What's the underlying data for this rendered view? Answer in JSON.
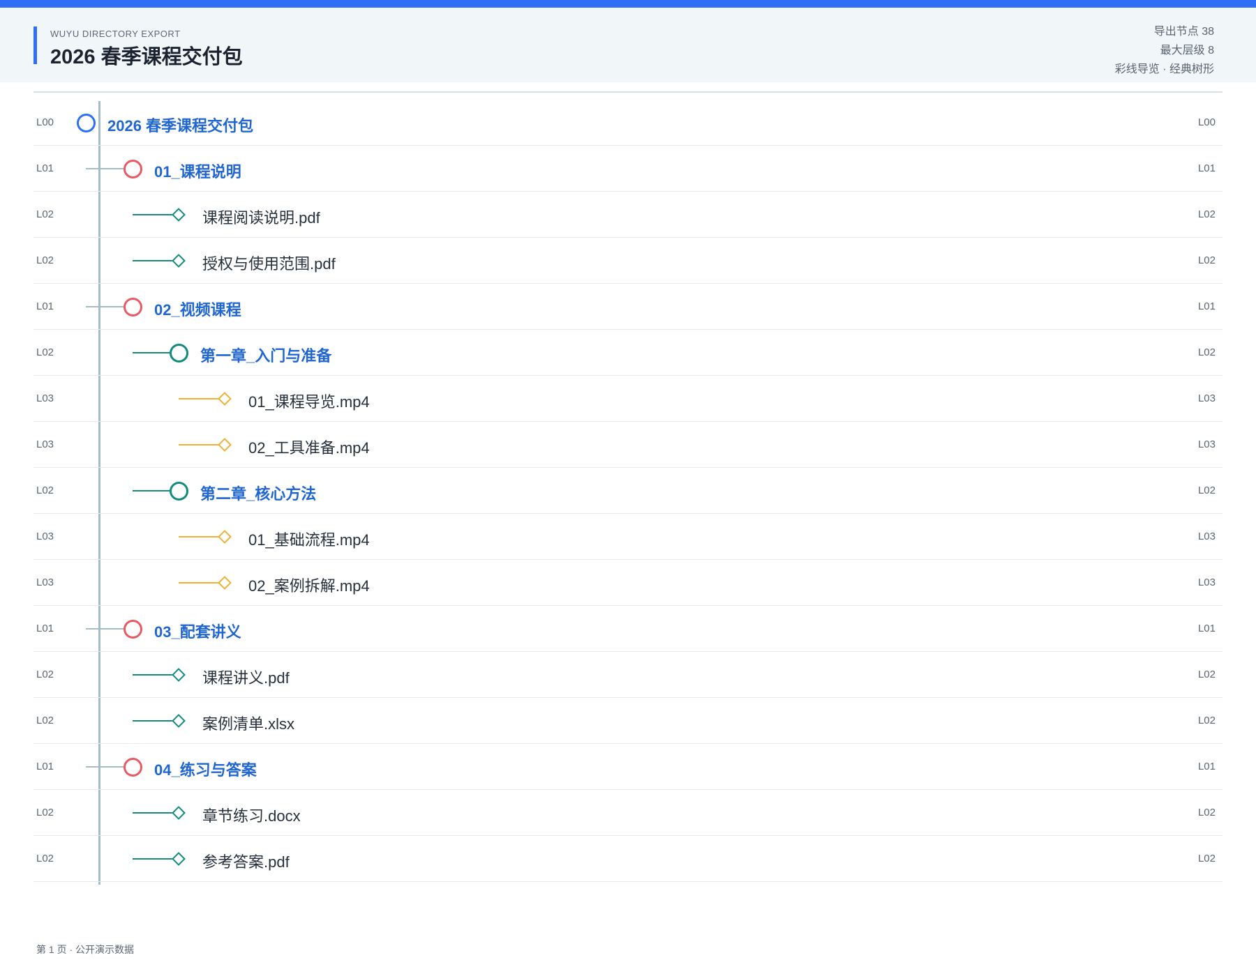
{
  "header": {
    "eyebrow": "WUYU DIRECTORY EXPORT",
    "title": "2026 春季课程交付包",
    "meta_nodes": "导出节点 38",
    "meta_depth": "最大层级 8",
    "meta_style": "彩线导览 · 经典树形"
  },
  "colors": {
    "accent": "#2f6ff5",
    "level1": "#e85a63",
    "level2": "#128a7d",
    "level3": "#efb034",
    "trunk": "#a4bcc6"
  },
  "tree": [
    {
      "level": "L00",
      "depth": 0,
      "type": "folder",
      "icon": "folder-circle-icon",
      "label": "2026 春季课程交付包"
    },
    {
      "level": "L01",
      "depth": 1,
      "type": "folder",
      "icon": "folder-circle-icon",
      "label": "01_课程说明"
    },
    {
      "level": "L02",
      "depth": 2,
      "type": "file",
      "icon": "file-diamond-icon",
      "label": "课程阅读说明.pdf"
    },
    {
      "level": "L02",
      "depth": 2,
      "type": "file",
      "icon": "file-diamond-icon",
      "label": "授权与使用范围.pdf"
    },
    {
      "level": "L01",
      "depth": 1,
      "type": "folder",
      "icon": "folder-circle-icon",
      "label": "02_视频课程"
    },
    {
      "level": "L02",
      "depth": 2,
      "type": "folder",
      "icon": "folder-circle-icon",
      "label": "第一章_入门与准备"
    },
    {
      "level": "L03",
      "depth": 3,
      "type": "file",
      "icon": "file-diamond-icon",
      "label": "01_课程导览.mp4"
    },
    {
      "level": "L03",
      "depth": 3,
      "type": "file",
      "icon": "file-diamond-icon",
      "label": "02_工具准备.mp4"
    },
    {
      "level": "L02",
      "depth": 2,
      "type": "folder",
      "icon": "folder-circle-icon",
      "label": "第二章_核心方法"
    },
    {
      "level": "L03",
      "depth": 3,
      "type": "file",
      "icon": "file-diamond-icon",
      "label": "01_基础流程.mp4"
    },
    {
      "level": "L03",
      "depth": 3,
      "type": "file",
      "icon": "file-diamond-icon",
      "label": "02_案例拆解.mp4"
    },
    {
      "level": "L01",
      "depth": 1,
      "type": "folder",
      "icon": "folder-circle-icon",
      "label": "03_配套讲义"
    },
    {
      "level": "L02",
      "depth": 2,
      "type": "file",
      "icon": "file-diamond-icon",
      "label": "课程讲义.pdf"
    },
    {
      "level": "L02",
      "depth": 2,
      "type": "file",
      "icon": "file-diamond-icon",
      "label": "案例清单.xlsx"
    },
    {
      "level": "L01",
      "depth": 1,
      "type": "folder",
      "icon": "folder-circle-icon",
      "label": "04_练习与答案"
    },
    {
      "level": "L02",
      "depth": 2,
      "type": "file",
      "icon": "file-diamond-icon",
      "label": "章节练习.docx"
    },
    {
      "level": "L02",
      "depth": 2,
      "type": "file",
      "icon": "file-diamond-icon",
      "label": "参考答案.pdf"
    }
  ],
  "footer": {
    "text": "第 1 页 · 公开演示数据"
  }
}
